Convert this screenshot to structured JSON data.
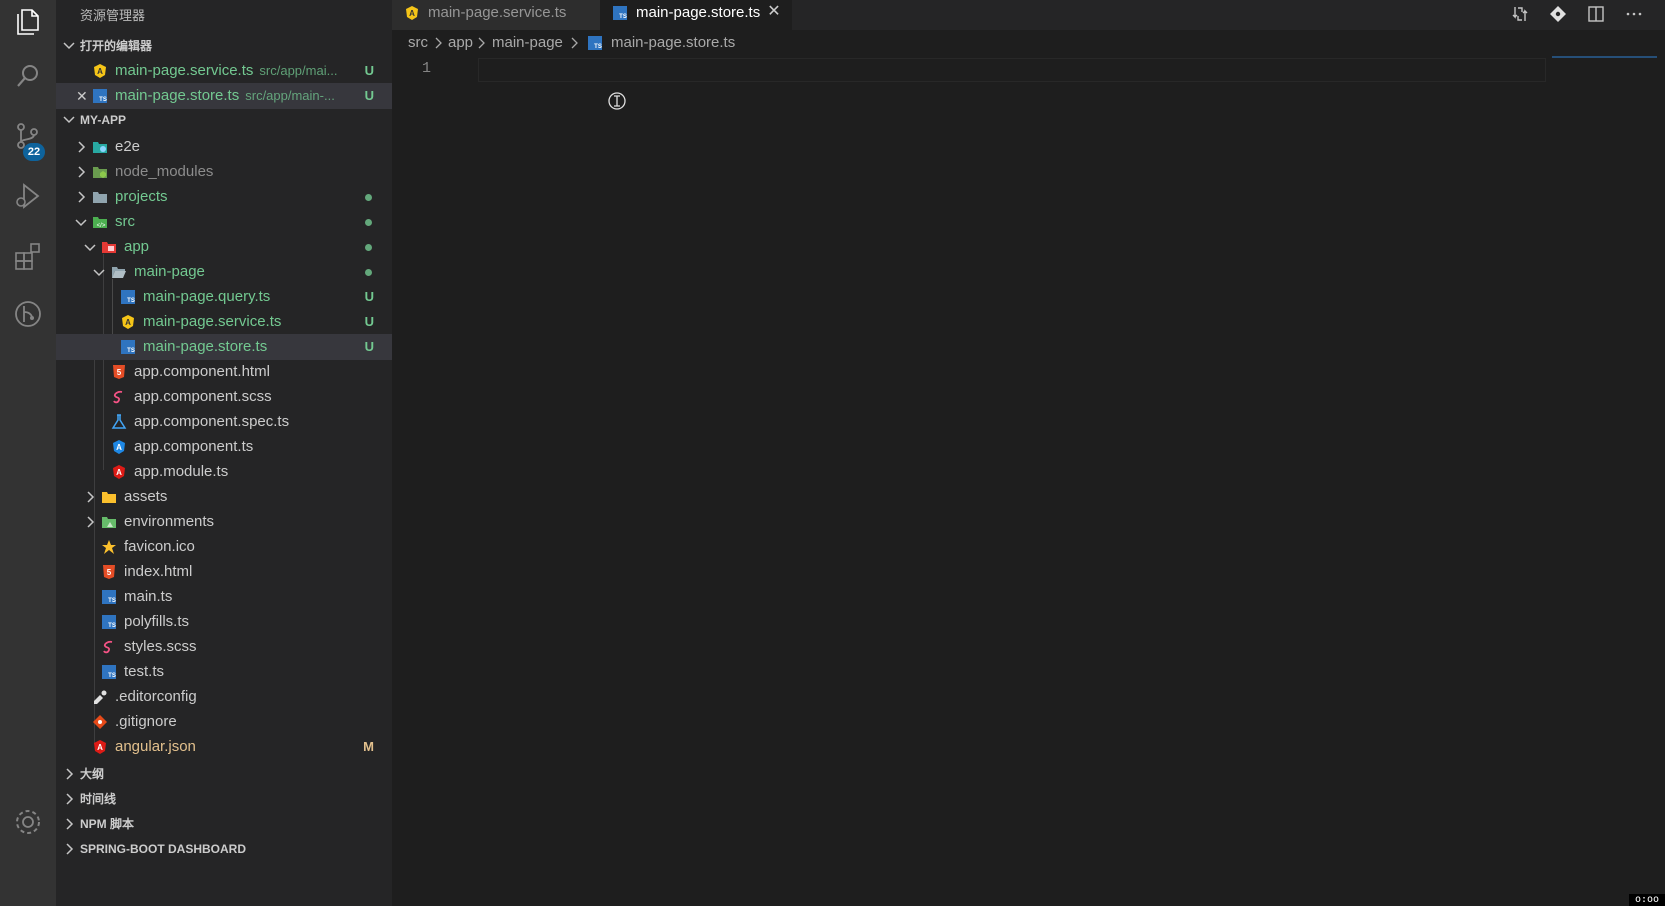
{
  "sidebar": {
    "title": "资源管理器",
    "open_editors": {
      "header": "打开的编辑器",
      "items": [
        {
          "name": "main-page.service.ts",
          "path": "src/app/mai...",
          "status": "U"
        },
        {
          "name": "main-page.store.ts",
          "path": "src/app/main-...",
          "status": "U"
        }
      ]
    },
    "project": {
      "header": "MY-APP",
      "tree": [
        {
          "name": "e2e"
        },
        {
          "name": "node_modules"
        },
        {
          "name": "projects"
        },
        {
          "name": "src"
        },
        {
          "name": "app"
        },
        {
          "name": "main-page"
        },
        {
          "name": "main-page.query.ts",
          "status": "U"
        },
        {
          "name": "main-page.service.ts",
          "status": "U"
        },
        {
          "name": "main-page.store.ts",
          "status": "U"
        },
        {
          "name": "app.component.html"
        },
        {
          "name": "app.component.scss"
        },
        {
          "name": "app.component.spec.ts"
        },
        {
          "name": "app.component.ts"
        },
        {
          "name": "app.module.ts"
        },
        {
          "name": "assets"
        },
        {
          "name": "environments"
        },
        {
          "name": "favicon.ico"
        },
        {
          "name": "index.html"
        },
        {
          "name": "main.ts"
        },
        {
          "name": "polyfills.ts"
        },
        {
          "name": "styles.scss"
        },
        {
          "name": "test.ts"
        },
        {
          "name": ".editorconfig"
        },
        {
          "name": ".gitignore"
        },
        {
          "name": "angular.json",
          "status": "M"
        }
      ]
    },
    "collapsed_sections": [
      "大纲",
      "时间线",
      "NPM 脚本",
      "SPRING-BOOT DASHBOARD"
    ]
  },
  "activity_bar": {
    "icons": [
      "files-icon",
      "search-icon",
      "source-control-icon",
      "run-debug-icon",
      "extensions-icon",
      "git-graph-icon",
      "settings-gear-icon"
    ],
    "source_control_badge": "22"
  },
  "tabs": [
    {
      "label": "main-page.service.ts",
      "active": false,
      "icon": "angular-service-icon"
    },
    {
      "label": "main-page.store.ts",
      "active": true,
      "icon": "typescript-icon"
    }
  ],
  "tab_close_glyph": "✕",
  "breadcrumb": {
    "items": [
      "src",
      "app",
      "main-page",
      "main-page.store.ts"
    ]
  },
  "editor": {
    "line_numbers": [
      "1"
    ]
  },
  "colors": {
    "untracked": "#73c991",
    "modified": "#e2c08d",
    "accent": "#0e639c"
  }
}
